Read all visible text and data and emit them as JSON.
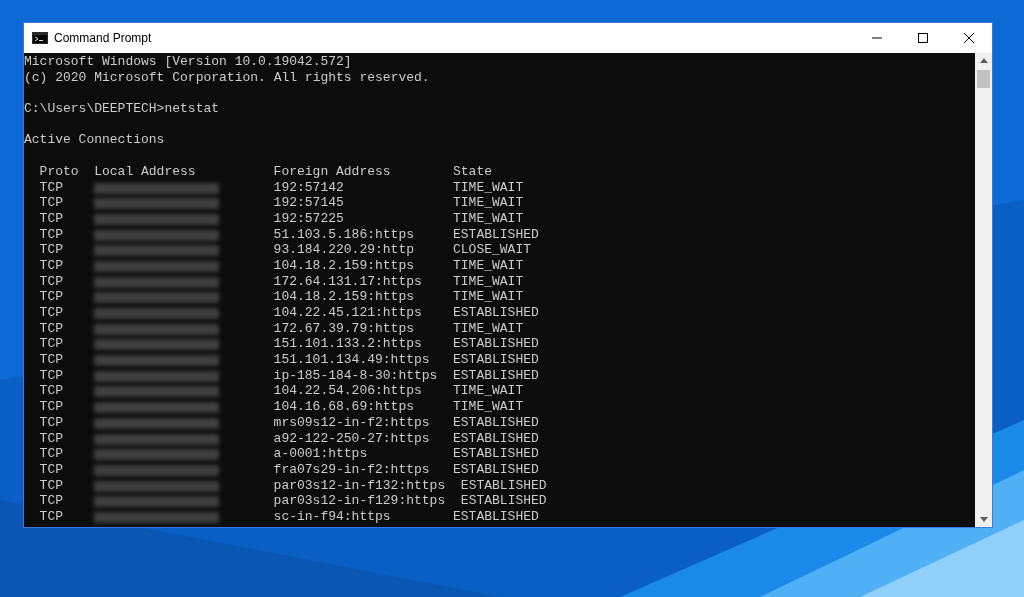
{
  "window": {
    "title": "Command Prompt"
  },
  "console": {
    "banner": [
      "Microsoft Windows [Version 10.0.19042.572]",
      "(c) 2020 Microsoft Corporation. All rights reserved."
    ],
    "prompt": "C:\\Users\\DEEPTECH>netstat",
    "section_title": "Active Connections",
    "columns": [
      "Proto",
      "Local Address",
      "Foreign Address",
      "State"
    ],
    "rows": [
      {
        "proto": "TCP",
        "foreign": "192:57142",
        "state": "TIME_WAIT"
      },
      {
        "proto": "TCP",
        "foreign": "192:57145",
        "state": "TIME_WAIT"
      },
      {
        "proto": "TCP",
        "foreign": "192:57225",
        "state": "TIME_WAIT"
      },
      {
        "proto": "TCP",
        "foreign": "51.103.5.186:https",
        "state": "ESTABLISHED"
      },
      {
        "proto": "TCP",
        "foreign": "93.184.220.29:http",
        "state": "CLOSE_WAIT"
      },
      {
        "proto": "TCP",
        "foreign": "104.18.2.159:https",
        "state": "TIME_WAIT"
      },
      {
        "proto": "TCP",
        "foreign": "172.64.131.17:https",
        "state": "TIME_WAIT"
      },
      {
        "proto": "TCP",
        "foreign": "104.18.2.159:https",
        "state": "TIME_WAIT"
      },
      {
        "proto": "TCP",
        "foreign": "104.22.45.121:https",
        "state": "ESTABLISHED"
      },
      {
        "proto": "TCP",
        "foreign": "172.67.39.79:https",
        "state": "TIME_WAIT"
      },
      {
        "proto": "TCP",
        "foreign": "151.101.133.2:https",
        "state": "ESTABLISHED"
      },
      {
        "proto": "TCP",
        "foreign": "151.101.134.49:https",
        "state": "ESTABLISHED"
      },
      {
        "proto": "TCP",
        "foreign": "ip-185-184-8-30:https",
        "state": "ESTABLISHED"
      },
      {
        "proto": "TCP",
        "foreign": "104.22.54.206:https",
        "state": "TIME_WAIT"
      },
      {
        "proto": "TCP",
        "foreign": "104.16.68.69:https",
        "state": "TIME_WAIT"
      },
      {
        "proto": "TCP",
        "foreign": "mrs09s12-in-f2:https",
        "state": "ESTABLISHED"
      },
      {
        "proto": "TCP",
        "foreign": "a92-122-250-27:https",
        "state": "ESTABLISHED"
      },
      {
        "proto": "TCP",
        "foreign": "a-0001:https",
        "state": "ESTABLISHED"
      },
      {
        "proto": "TCP",
        "foreign": "fra07s29-in-f2:https",
        "state": "ESTABLISHED"
      },
      {
        "proto": "TCP",
        "foreign": "par03s12-in-f132:https",
        "state": "ESTABLISHED"
      },
      {
        "proto": "TCP",
        "foreign": "par03s12-in-f129:https",
        "state": "ESTABLISHED"
      },
      {
        "proto": "TCP",
        "foreign": "sc-in-f94:https",
        "state": "ESTABLISHED"
      }
    ]
  }
}
